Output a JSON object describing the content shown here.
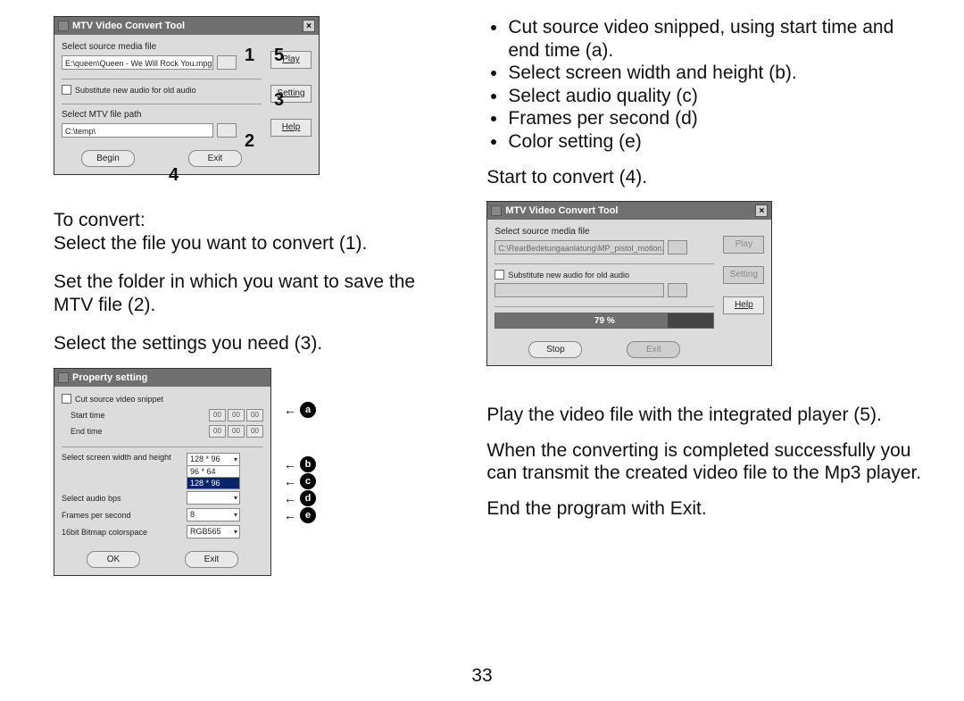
{
  "page_number": "33",
  "main_window": {
    "title": "MTV Video Convert Tool",
    "label_source": "Select source media file",
    "source_value": "E:\\queen\\Queen - We Will Rock You.mpg",
    "chk_label": "Substitute new audio for old audio",
    "label_path": "Select MTV file path",
    "path_value": "C:\\temp\\",
    "btn_play": "Play",
    "btn_setting": "Setting",
    "btn_help": "Help",
    "btn_begin": "Begin",
    "btn_exit": "Exit"
  },
  "callouts": {
    "1": "1",
    "2": "2",
    "3": "3",
    "4": "4",
    "5": "5"
  },
  "left_text": {
    "p1": "To convert:",
    "p2": "Select the file you want to convert (1).",
    "p3": "Set the folder in which you want to save the MTV file (2).",
    "p4": "Select the settings you need (3)."
  },
  "prop_window": {
    "title": "Property setting",
    "chk_cut": "Cut source video snippet",
    "lbl_start": "Start time",
    "lbl_end": "End time",
    "lbl_wh": "Select screen width and height",
    "lbl_bps": "Select audio bps",
    "lbl_fps": "Frames per second",
    "lbl_colorspace": "16bit Bitmap colorspace",
    "wh_selected": "128 * 96",
    "wh_opt2": "96 * 64",
    "wh_opt3": "128 * 96",
    "fps_value": "8",
    "color_value": "RGB565",
    "btn_ok": "OK",
    "btn_exit": "Exit",
    "spin_zero": "00"
  },
  "circle": {
    "a": "a",
    "b": "b",
    "c": "c",
    "d": "d",
    "e": "e"
  },
  "right_bullets": {
    "a": "Cut source video snipped, using start time and end time (a).",
    "b": "Select screen width and height (b).",
    "c": "Select audio quality (c)",
    "d": "Frames per second (d)",
    "e": "Color setting (e)"
  },
  "right_text": {
    "p1": "Start to convert (4).",
    "p2": "Play the video file with the integrated player (5).",
    "p3": "When the converting is completed successfully you can transmit the created video file to the Mp3 player.",
    "p4": "End the program with Exit."
  },
  "progress_window": {
    "title": "MTV Video Convert Tool",
    "label_source": "Select source media file",
    "source_value": "C:\\RearBedetungaanlatung\\MP_pistol_motion.wmv",
    "chk_label": "Substitute new audio for old audio",
    "btn_play": "Play",
    "btn_setting": "Setting",
    "btn_help": "Help",
    "btn_stop": "Stop",
    "btn_exit": "Exit",
    "progress_text": "79 %",
    "progress_pct": 79
  }
}
